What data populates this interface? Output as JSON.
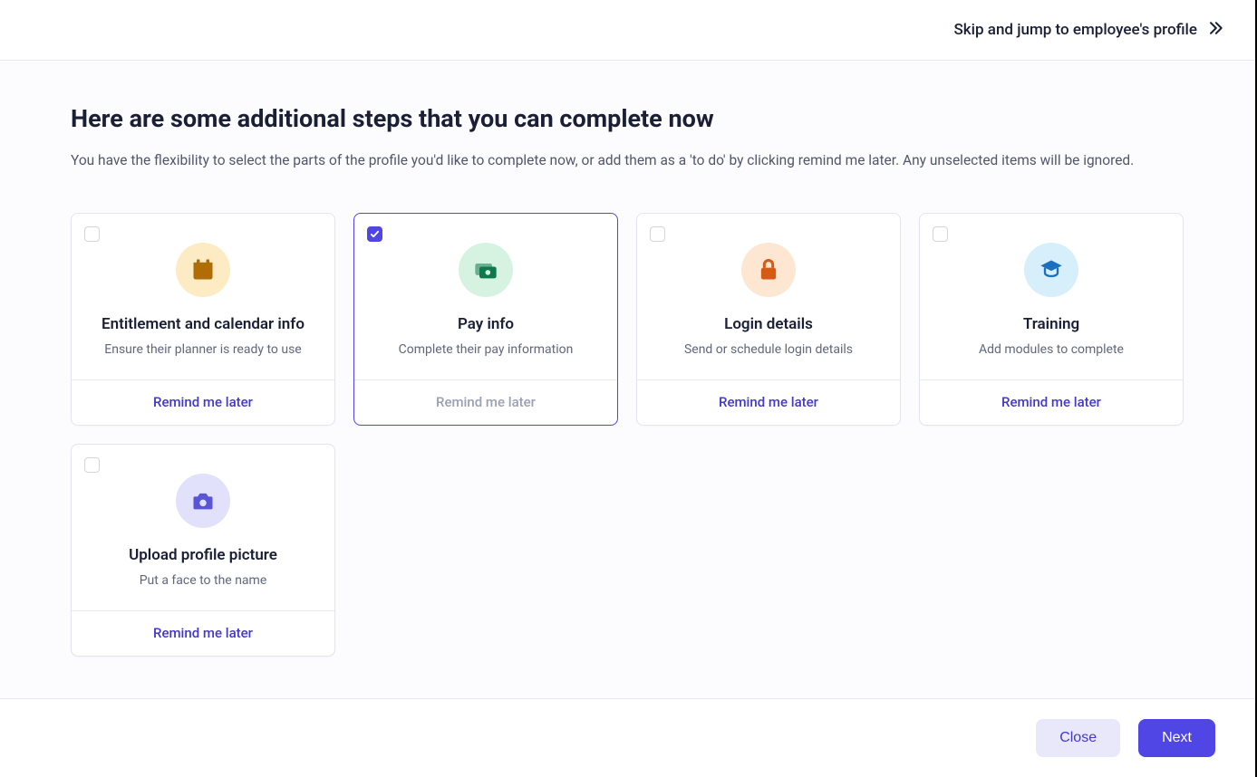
{
  "header": {
    "skip_label": "Skip and jump to employee's profile"
  },
  "page": {
    "title": "Here are some additional steps that you can complete now",
    "subtitle": "You have the flexibility to select the parts of the profile you'd like to complete now, or add them as a 'to do' by clicking remind me later. Any unselected items will be ignored."
  },
  "remind_label": "Remind me later",
  "cards": [
    {
      "id": "entitlement",
      "title": "Entitlement and calendar info",
      "desc": "Ensure their planner is ready to use",
      "checked": false,
      "icon": "calendar-icon",
      "color": "amber"
    },
    {
      "id": "pay",
      "title": "Pay info",
      "desc": "Complete their pay information",
      "checked": true,
      "icon": "money-icon",
      "color": "green"
    },
    {
      "id": "login",
      "title": "Login details",
      "desc": "Send or schedule login details",
      "checked": false,
      "icon": "lock-icon",
      "color": "peach"
    },
    {
      "id": "training",
      "title": "Training",
      "desc": "Add modules to complete",
      "checked": false,
      "icon": "graduation-icon",
      "color": "blue"
    },
    {
      "id": "photo",
      "title": "Upload profile picture",
      "desc": "Put a face to the name",
      "checked": false,
      "icon": "camera-icon",
      "color": "purple"
    }
  ],
  "footer": {
    "close_label": "Close",
    "next_label": "Next"
  },
  "colors": {
    "primary": "#5046e5",
    "secondary_bg": "#e9e8fb",
    "text": "#1a1f36",
    "muted": "#62667c",
    "border": "#e5e7ef"
  }
}
